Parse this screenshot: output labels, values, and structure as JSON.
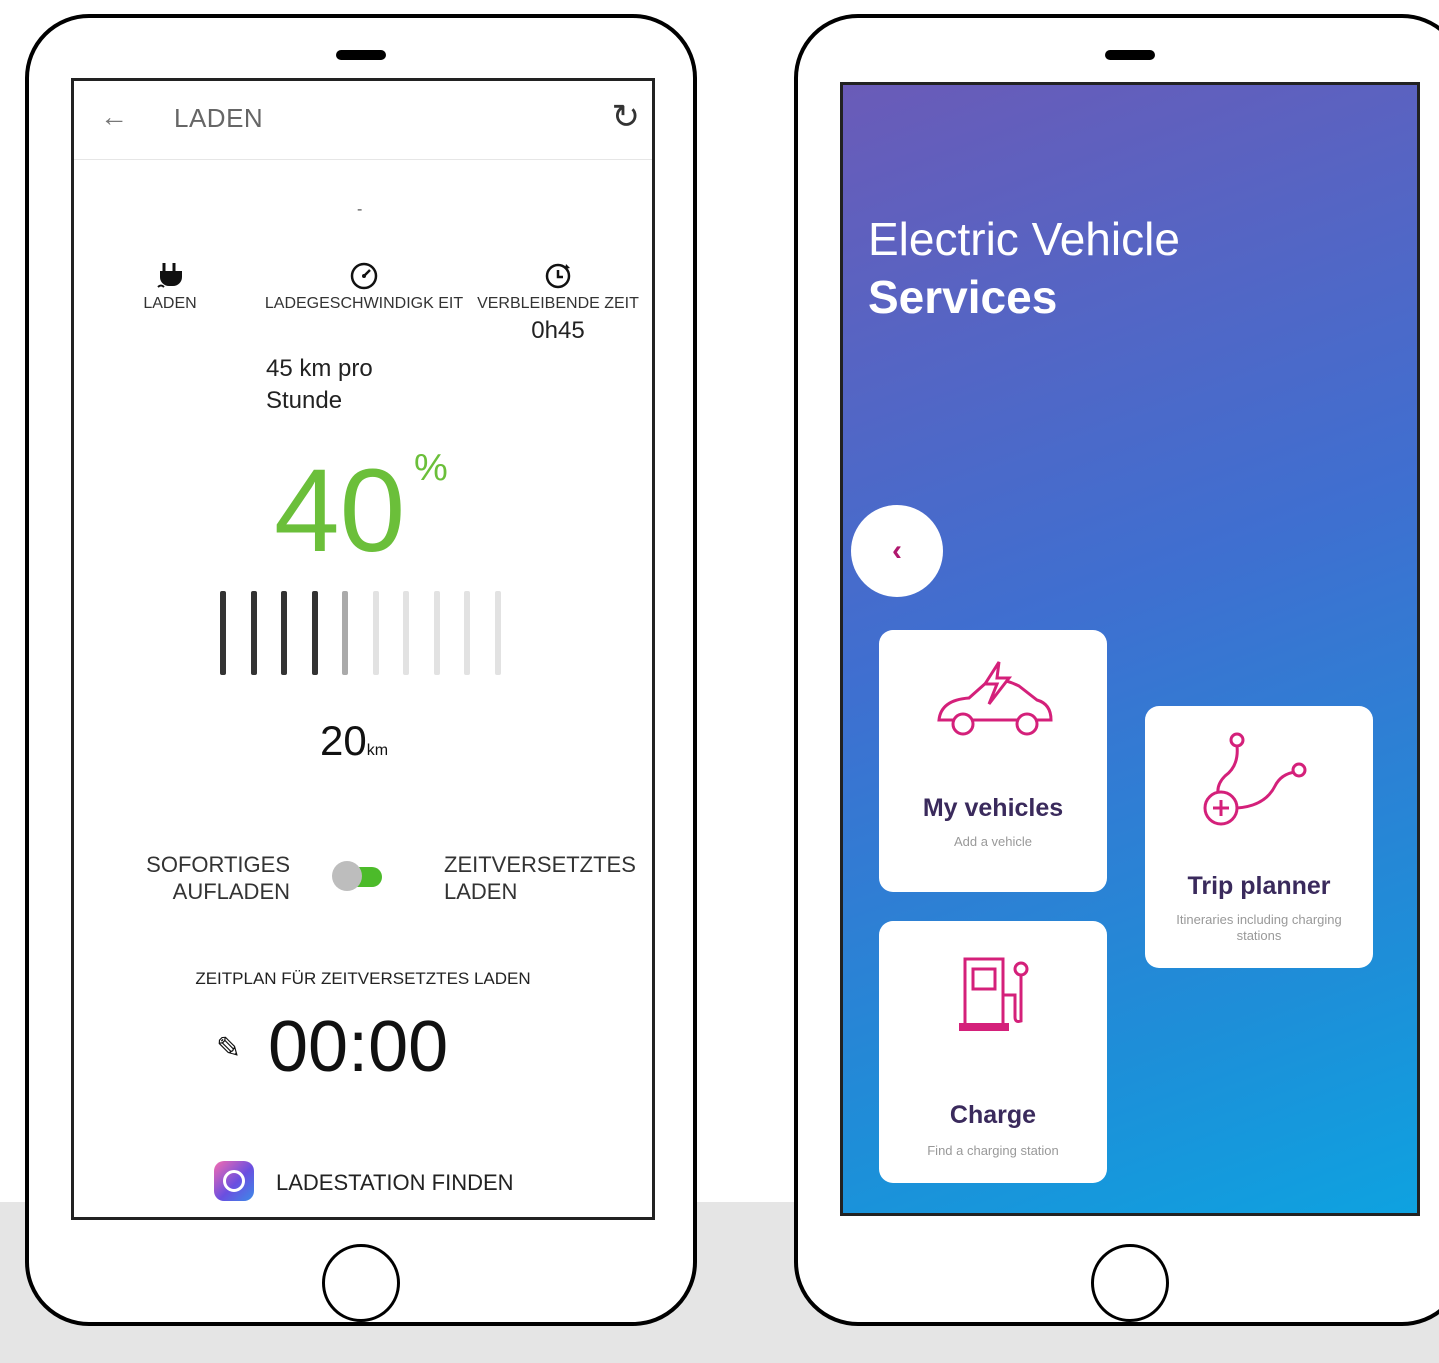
{
  "left_app": {
    "title": "LADEN",
    "back_icon": "arrow-left-icon",
    "refresh_icon": "refresh-icon",
    "dash": "-",
    "stats": [
      {
        "icon": "plug-icon",
        "label": "LADEN",
        "value": ""
      },
      {
        "icon": "speedometer-icon",
        "label": "LADEGESCHWINDIGK EIT",
        "value": "45 km pro Stunde"
      },
      {
        "icon": "clock-icon",
        "label": "VERBLEIBENDE ZEIT",
        "value": "0h45"
      }
    ],
    "battery_percent": "40",
    "percent_sign": "%",
    "range_value": "20",
    "range_unit": "km",
    "charge_level": 0.4,
    "toggle_left": "SOFORTIGES AUFLADEN",
    "toggle_right": "ZEITVERSETZTES LADEN",
    "schedule_label": "ZEITPLAN FÜR ZEITVERSETZTES LADEN",
    "schedule_time": "00:00",
    "station_button": "LADESTATION FINDEN",
    "colors": {
      "accent": "#6bbf3a",
      "toggle_track": "#4cbb2a"
    }
  },
  "right_app": {
    "heading_line1": "Electric Vehicle",
    "heading_line2": "Services",
    "back_icon": "chevron-left-icon",
    "cards": [
      {
        "title": "My vehicles",
        "subtitle": "Add a vehicle",
        "icon": "electric-car-icon"
      },
      {
        "title": "Trip planner",
        "subtitle": "Itineraries including charging stations",
        "icon": "route-icon"
      },
      {
        "title": "Charge",
        "subtitle": "Find a charging station",
        "icon": "charging-station-icon"
      }
    ],
    "colors": {
      "gradient_top": "#6a5bb8",
      "gradient_bottom": "#0ea2e0",
      "icon_pink": "#d4207a",
      "title": "#3a2a5c"
    }
  }
}
